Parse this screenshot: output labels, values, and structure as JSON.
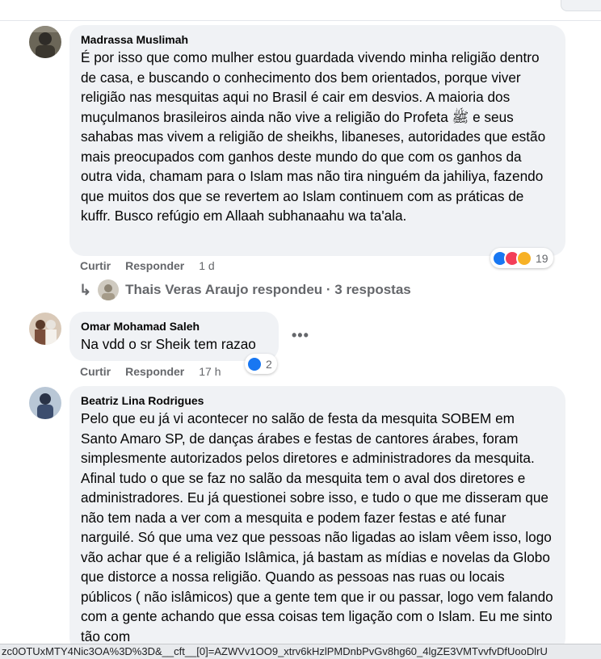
{
  "comments": [
    {
      "author": "Madrassa Muslimah",
      "text": "É por isso que como mulher estou guardada vivendo minha religião dentro de casa, e buscando o conhecimento dos bem orientados, porque viver religião nas mesquitas aqui no Brasil é cair em desvios. A maioria dos muçulmanos brasileiros ainda não vive a religião do Profeta ﷺ e seus sahabas mas vivem a religião de sheikhs, libaneses, autoridades que estão mais preocupados com ganhos deste mundo do que com os ganhos da outra vida, chamam para o Islam mas não tira ninguém da jahiliya, fazendo que muitos dos que se revertem ao Islam continuem com as práticas de kuffr. Busco refúgio em Allaah subhanaahu wa ta'ala.",
      "like_label": "Curtir",
      "reply_label": "Responder",
      "time": "1 d",
      "reactions": [
        "like",
        "love",
        "care"
      ],
      "reaction_count": "19",
      "replies_summary": "Thais Veras Araujo respondeu · 3 respostas"
    },
    {
      "author": "Omar Mohamad Saleh",
      "text": "Na vdd o sr Sheik tem razao",
      "like_label": "Curtir",
      "reply_label": "Responder",
      "time": "17 h",
      "reactions": [
        "like"
      ],
      "reaction_count": "2",
      "more_options": "•••"
    },
    {
      "author": "Beatriz Lina Rodrigues",
      "text": "Pelo que eu já vi acontecer no salão de festa da mesquita SOBEM em Santo Amaro SP, de danças árabes e festas de cantores árabes, foram simplesmente autorizados pelos diretores e administradores da mesquita. Afinal tudo o que se faz no salão da mesquita tem o aval dos diretores e administradores. Eu já questionei sobre isso, e tudo o que me disseram que não tem nada a ver com a mesquita e podem fazer festas e até funar narguilé. Só que uma vez que pessoas não ligadas ao islam vêem isso, logo vão achar que é a religião Islâmica, já bastam as mídias e novelas da Globo que distorce a nossa religião. Quando as pessoas nas ruas ou locais públicos ( não islâmicos) que a gente tem que ir ou passar, logo vem falando com a gente achando que essa coisas tem ligação com o Islam. Eu me sinto tão com"
    }
  ],
  "status_url": "zc0OTUxMTY4Nic3OA%3D%3D&__cft__[0]=AZWVv1OO9_xtrv6kHzlPMDnbPvGv8hg60_4lgZE3VMTvvfvDfUooDlrU",
  "colors": {
    "like": "#1877f2",
    "love": "#f33e58",
    "care": "#f7b125",
    "bubble": "#f0f2f5",
    "meta": "#65676b"
  }
}
